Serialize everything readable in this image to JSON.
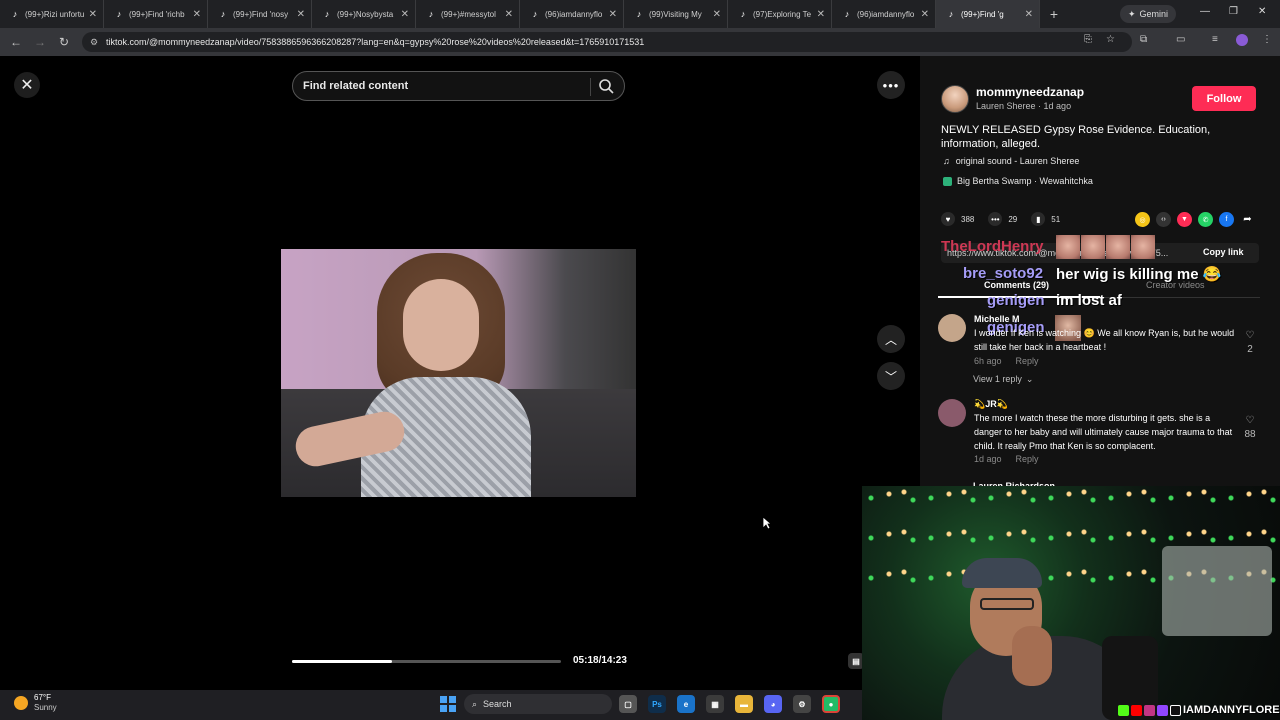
{
  "browser": {
    "tabs": [
      {
        "label": "(99+)Rizi unfortu",
        "active": false
      },
      {
        "label": "(99+)Find 'richb",
        "active": false
      },
      {
        "label": "(99+)Find 'nosy",
        "active": false
      },
      {
        "label": "(99+)Nosybysta",
        "active": false
      },
      {
        "label": "(99+)#messytol",
        "active": false
      },
      {
        "label": "(96)iamdannyflo",
        "active": false
      },
      {
        "label": "(99)Visiting My",
        "active": false
      },
      {
        "label": "(97)Exploring Te",
        "active": false
      },
      {
        "label": "(96)iamdannyflo",
        "active": false
      },
      {
        "label": "(99+)Find 'g",
        "active": true
      }
    ],
    "gemini_label": "Gemini",
    "url": "tiktok.com/@mommyneedzanap/video/7583886596366208287?lang=en&q=gypsy%20rose%20videos%20released&t=1765910171531"
  },
  "player": {
    "search_placeholder": "Find related content",
    "progress_fraction": 0.37,
    "timecode": "05:18/14:23"
  },
  "post": {
    "handle": "mommyneedzanap",
    "byline": "Lauren Sheree · 1d ago",
    "follow_label": "Follow",
    "description": "NEWLY RELEASED Gypsy Rose Evidence. Education, information, alleged.",
    "sound": "original sound - Lauren Sheree",
    "location": "Big Bertha Swamp · Wewahitchka",
    "likes": "388",
    "comments": "29",
    "saves": "51",
    "link_text": "https://www.tiktok.com/@mommyneedzanap/video/75...",
    "copy_label": "Copy link",
    "tab_comments": "Comments (29)",
    "tab_creator": "Creator videos"
  },
  "overlay": {
    "red_name": "TheLordHenry",
    "msg1_user": "bre_soto92",
    "msg1_text": "her wig is killing me 😂",
    "msg2_user": "genigen",
    "msg2_text": "im lost af",
    "msg3_user": "genigen"
  },
  "comments": [
    {
      "name": "Michelle M",
      "text": "I wonder if Ken is watching 😊 We all know Ryan is, but he would still take her back in a heartbeat !",
      "time": "6h ago",
      "reply": "Reply",
      "likes": "2",
      "avatar_color": "#c4a58a"
    },
    {
      "name": "💫JR💫",
      "text": "The more I watch these the more disturbing it gets. she is a danger to her baby and will ultimately cause major trauma to that child. It really Pmo that Ken is so complacent.",
      "time": "1d ago",
      "reply": "Reply",
      "likes": "88",
      "avatar_color": "#8a5a6b"
    }
  ],
  "view_replies": "View 1 reply",
  "next_commenter": "Lauren Richardson",
  "webcam": {
    "tag": "IAMDANNYFLORES"
  },
  "taskbar": {
    "temp": "67°F",
    "condition": "Sunny",
    "search_label": "Search"
  },
  "colors": {
    "accent": "#fe2c55",
    "chat_name": "#a59cf7"
  }
}
